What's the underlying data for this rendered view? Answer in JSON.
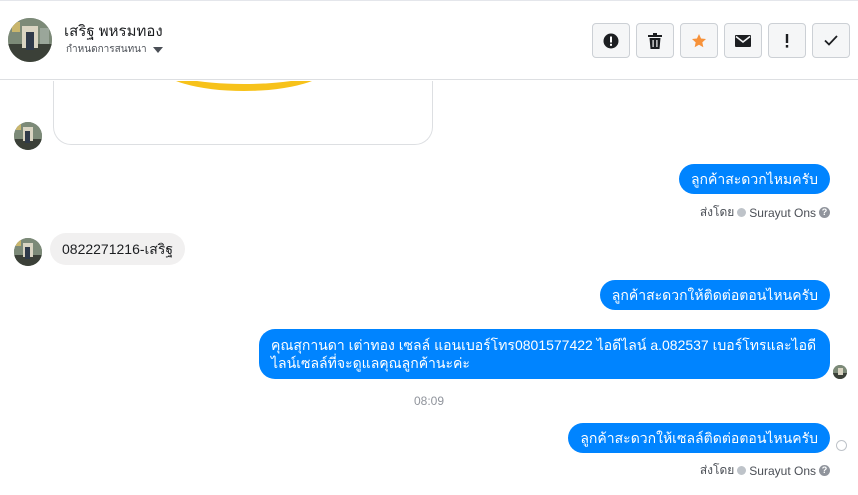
{
  "header": {
    "contact_name": "เสริฐ พหรมทอง",
    "subtitle": "กำหนดการสนทนา",
    "toolbar": [
      {
        "icon": "alert-circle-icon",
        "name": "spam-button"
      },
      {
        "icon": "trash-icon",
        "name": "delete-button"
      },
      {
        "icon": "star-icon",
        "name": "star-button"
      },
      {
        "icon": "envelope-icon",
        "name": "mark-unread-button"
      },
      {
        "icon": "exclamation-icon",
        "name": "follow-up-button"
      },
      {
        "icon": "check-icon",
        "name": "done-button"
      }
    ],
    "star_color": "#f7923a"
  },
  "messages": {
    "out1": "ลูกค้าสะดวกไหมครับ",
    "sent_by_1_prefix": "ส่งโดย",
    "sent_by_1_agent": "Surayut Ons",
    "in1": "0822271216-เสริฐ",
    "out2": "ลูกค้าสะดวกให้ติดต่อตอนไหนครับ",
    "out3": "คุณสุกานดา เต่าทอง  เซลล์ แอนเบอร์โทร0801577422 ไอดีไลน์ a.082537  เบอร์โทรและไอดีไลน์เซลล์ที่จะดูแลคุณลูกค้านะค่ะ",
    "time": "08:09",
    "out4": "ลูกค้าสะดวกให้เซลล์ติดต่อตอนไหนครับ",
    "sent_by_2_prefix": "ส่งโดย",
    "sent_by_2_agent": "Surayut Ons"
  },
  "colors": {
    "outgoing_bubble": "#0084ff",
    "incoming_bubble": "#f1f0f0"
  }
}
